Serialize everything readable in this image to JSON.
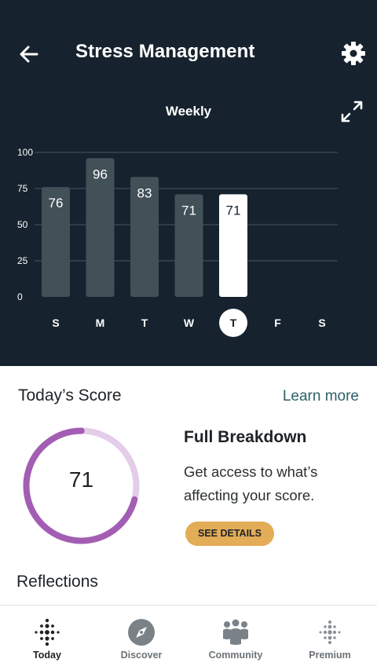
{
  "header": {
    "title": "Stress Management",
    "back_icon": "arrow-left-icon",
    "settings_icon": "gear-icon",
    "period": "Weekly",
    "expand_icon": "expand-icon"
  },
  "chart_data": {
    "type": "bar",
    "categories": [
      "S",
      "M",
      "T",
      "W",
      "T",
      "F",
      "S"
    ],
    "values": [
      76,
      96,
      83,
      71,
      71,
      null,
      null
    ],
    "yticks": [
      0,
      25,
      50,
      75,
      100
    ],
    "ylim": [
      0,
      100
    ],
    "highlight_index": 4,
    "grid": true,
    "colors": {
      "bar": "#425058",
      "highlight_bar": "#ffffff",
      "background": "#16232e",
      "grid": "#4a5660"
    }
  },
  "score": {
    "title": "Today’s Score",
    "learn_more": "Learn more",
    "value": "71",
    "ring_value": 71,
    "ring_max": 100,
    "ring_color": "#a35eb3",
    "ring_track_color": "#e3cde8"
  },
  "breakdown": {
    "title": "Full Breakdown",
    "description": "Get access to what’s affecting your score.",
    "button": "SEE DETAILS"
  },
  "reflections": {
    "title": "Reflections"
  },
  "nav": {
    "items": [
      {
        "label": "Today",
        "icon": "fitbit-dots-icon",
        "active": true
      },
      {
        "label": "Discover",
        "icon": "compass-icon",
        "active": false
      },
      {
        "label": "Community",
        "icon": "community-icon",
        "active": false
      },
      {
        "label": "Premium",
        "icon": "premium-dots-icon",
        "active": false
      }
    ]
  }
}
